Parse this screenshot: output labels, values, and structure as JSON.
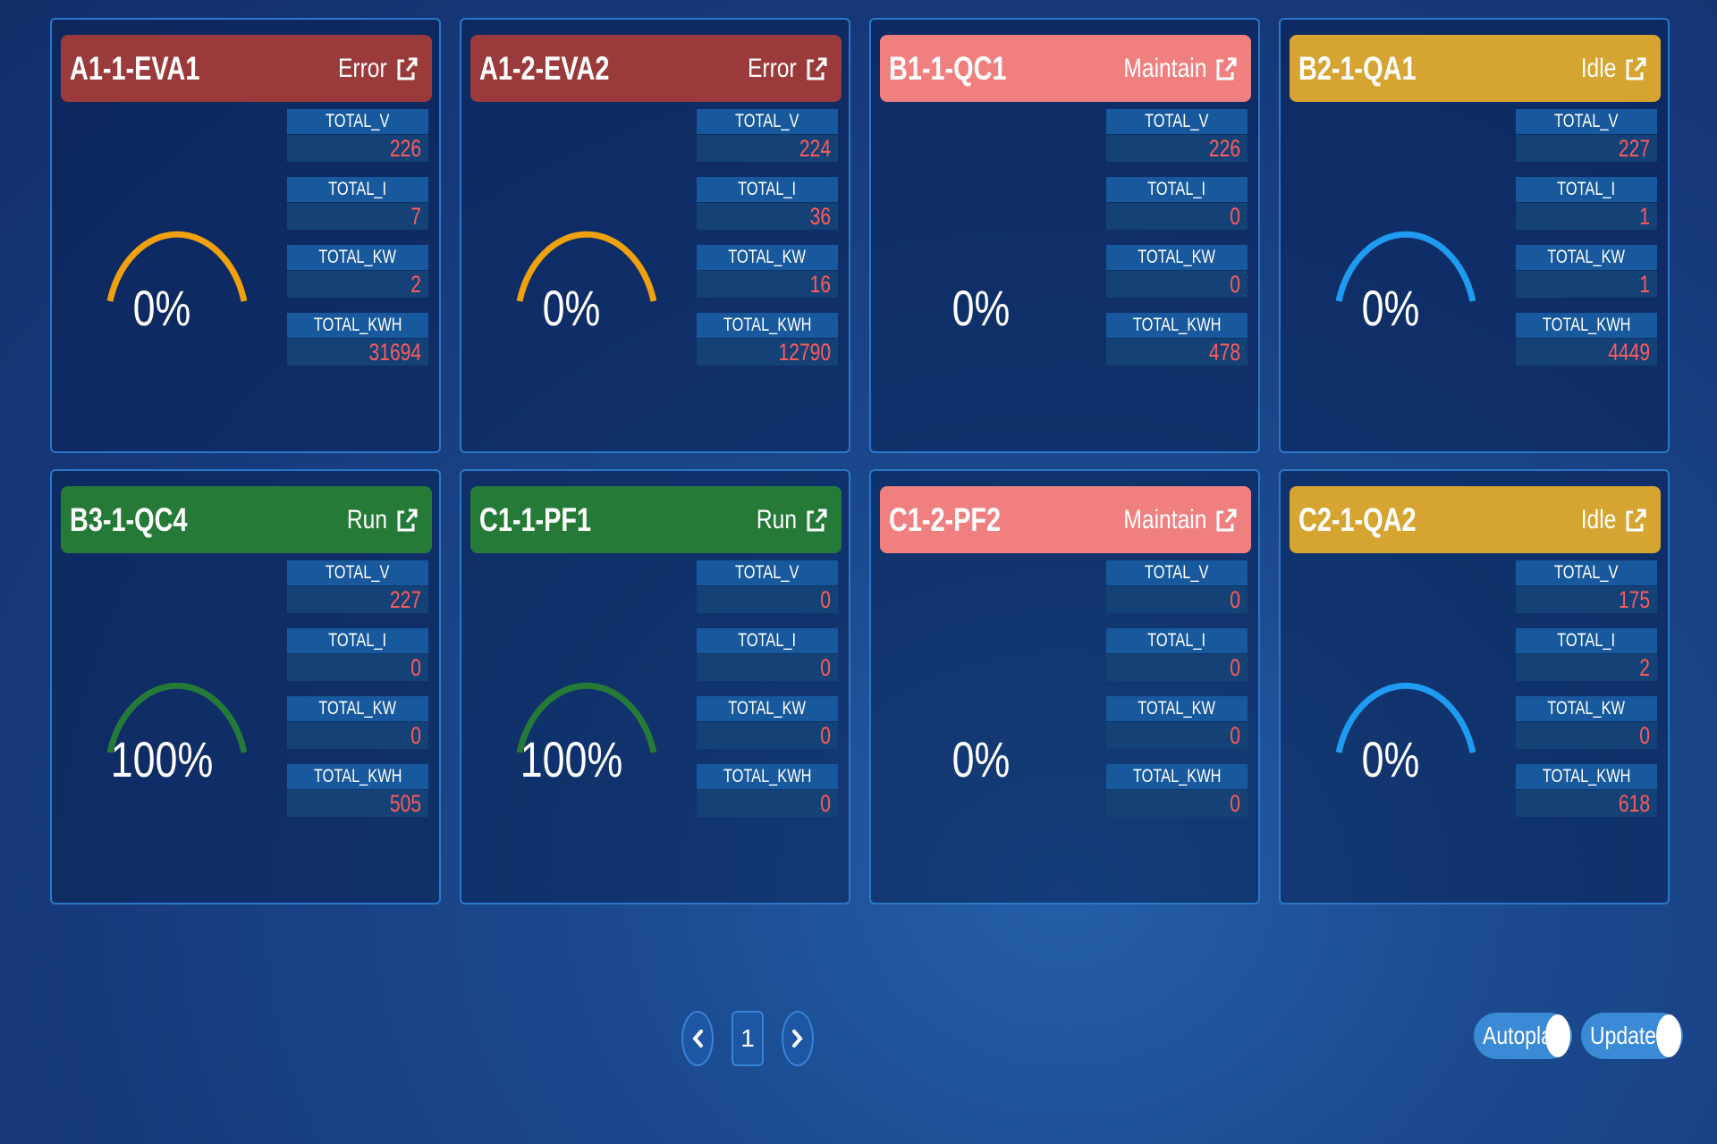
{
  "cards": [
    {
      "name": "A1-1-EVA1",
      "status": "Error",
      "status_color": "#9b3a3a",
      "gauge_color": "#f0a20e",
      "gauge_visible": true,
      "percent": "0%",
      "metrics": [
        {
          "label": "TOTAL_V",
          "value": "226"
        },
        {
          "label": "TOTAL_I",
          "value": "7"
        },
        {
          "label": "TOTAL_KW",
          "value": "2"
        },
        {
          "label": "TOTAL_KWH",
          "value": "31694"
        }
      ]
    },
    {
      "name": "A1-2-EVA2",
      "status": "Error",
      "status_color": "#9b3a3a",
      "gauge_color": "#f0a20e",
      "gauge_visible": true,
      "percent": "0%",
      "metrics": [
        {
          "label": "TOTAL_V",
          "value": "224"
        },
        {
          "label": "TOTAL_I",
          "value": "36"
        },
        {
          "label": "TOTAL_KW",
          "value": "16"
        },
        {
          "label": "TOTAL_KWH",
          "value": "12790"
        }
      ]
    },
    {
      "name": "B1-1-QC1",
      "status": "Maintain",
      "status_color": "#f08080",
      "gauge_color": "#f08080",
      "gauge_visible": false,
      "percent": "0%",
      "metrics": [
        {
          "label": "TOTAL_V",
          "value": "226"
        },
        {
          "label": "TOTAL_I",
          "value": "0"
        },
        {
          "label": "TOTAL_KW",
          "value": "0"
        },
        {
          "label": "TOTAL_KWH",
          "value": "478"
        }
      ]
    },
    {
      "name": "B2-1-QA1",
      "status": "Idle",
      "status_color": "#d6a431",
      "gauge_color": "#1f9bf0",
      "gauge_visible": true,
      "percent": "0%",
      "metrics": [
        {
          "label": "TOTAL_V",
          "value": "227"
        },
        {
          "label": "TOTAL_I",
          "value": "1"
        },
        {
          "label": "TOTAL_KW",
          "value": "1"
        },
        {
          "label": "TOTAL_KWH",
          "value": "4449"
        }
      ]
    },
    {
      "name": "B3-1-QC4",
      "status": "Run",
      "status_color": "#267a38",
      "gauge_color": "#267a38",
      "gauge_visible": true,
      "percent": "100%",
      "metrics": [
        {
          "label": "TOTAL_V",
          "value": "227"
        },
        {
          "label": "TOTAL_I",
          "value": "0"
        },
        {
          "label": "TOTAL_KW",
          "value": "0"
        },
        {
          "label": "TOTAL_KWH",
          "value": "505"
        }
      ]
    },
    {
      "name": "C1-1-PF1",
      "status": "Run",
      "status_color": "#267a38",
      "gauge_color": "#267a38",
      "gauge_visible": true,
      "percent": "100%",
      "metrics": [
        {
          "label": "TOTAL_V",
          "value": "0"
        },
        {
          "label": "TOTAL_I",
          "value": "0"
        },
        {
          "label": "TOTAL_KW",
          "value": "0"
        },
        {
          "label": "TOTAL_KWH",
          "value": "0"
        }
      ]
    },
    {
      "name": "C1-2-PF2",
      "status": "Maintain",
      "status_color": "#f08080",
      "gauge_color": "#f08080",
      "gauge_visible": false,
      "percent": "0%",
      "metrics": [
        {
          "label": "TOTAL_V",
          "value": "0"
        },
        {
          "label": "TOTAL_I",
          "value": "0"
        },
        {
          "label": "TOTAL_KW",
          "value": "0"
        },
        {
          "label": "TOTAL_KWH",
          "value": "0"
        }
      ]
    },
    {
      "name": "C2-1-QA2",
      "status": "Idle",
      "status_color": "#d6a431",
      "gauge_color": "#1f9bf0",
      "gauge_visible": true,
      "percent": "0%",
      "metrics": [
        {
          "label": "TOTAL_V",
          "value": "175"
        },
        {
          "label": "TOTAL_I",
          "value": "2"
        },
        {
          "label": "TOTAL_KW",
          "value": "0"
        },
        {
          "label": "TOTAL_KWH",
          "value": "618"
        }
      ]
    }
  ],
  "pagination": {
    "current_page": "1",
    "prev_icon": "chevron-left-icon",
    "next_icon": "chevron-right-icon"
  },
  "toggles": {
    "autoplay_label": "Autoplay",
    "update_label": "Update"
  },
  "colors": {
    "metric_value": "#ff5b5b",
    "card_border": "#2b78c9",
    "toggle_bg": "#3b8ad6"
  }
}
